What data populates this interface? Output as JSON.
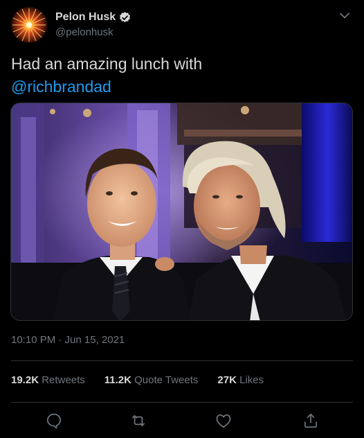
{
  "author": {
    "display_name": "Pelon Husk",
    "handle": "@pelonhusk",
    "verified": true
  },
  "tweet": {
    "text_before_mention": "Had an amazing lunch with",
    "mention": "@richbrandad",
    "timestamp": "10:10 PM · Jun 15, 2021"
  },
  "stats": {
    "retweets_count": "19.2K",
    "retweets_label": "Retweets",
    "quote_count": "11.2K",
    "quote_label": "Quote Tweets",
    "likes_count": "27K",
    "likes_label": "Likes"
  },
  "icons": {
    "more": "chevron-down-icon",
    "reply": "reply-icon",
    "retweet": "retweet-icon",
    "like": "heart-icon",
    "share": "share-icon"
  },
  "colors": {
    "background": "#000000",
    "text": "#d9d9d9",
    "secondary": "#6e767d",
    "accent": "#1d9bf0",
    "divider": "#2f3336"
  }
}
